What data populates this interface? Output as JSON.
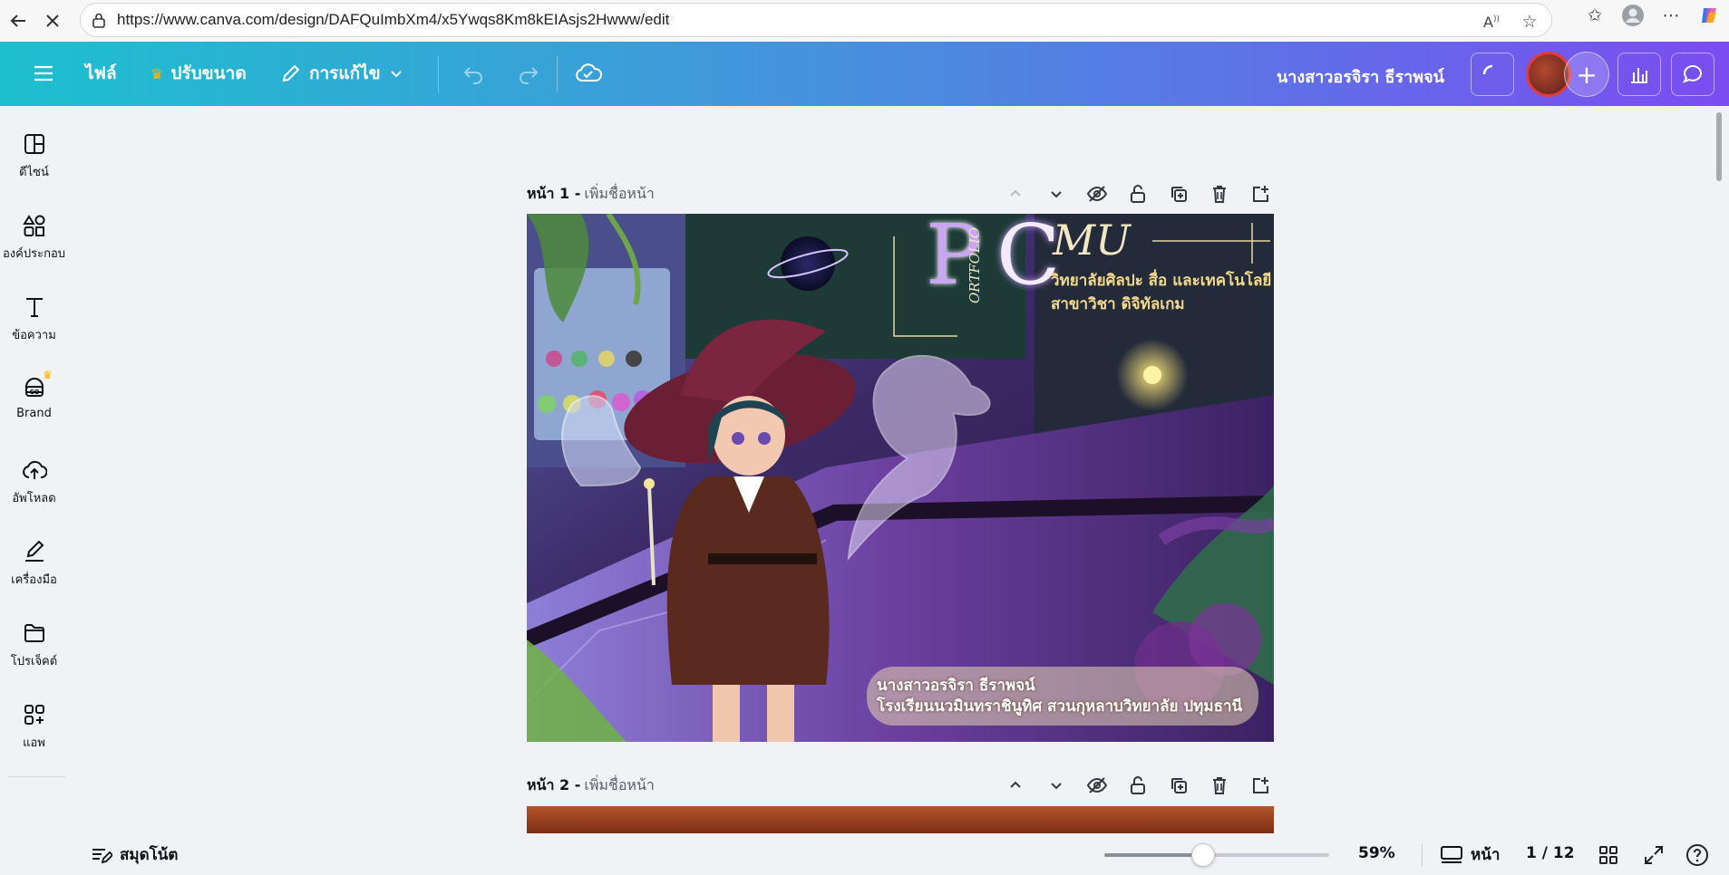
{
  "browser": {
    "url": "https://www.canva.com/design/DAFQuImbXm4/x5Ywqs8Km8kEIAsjs2Hwww/edit"
  },
  "header": {
    "file_label": "ไฟล์",
    "resize_label": "ปรับขนาด",
    "edit_label": "การแก้ไข",
    "design_title": "นางสาวอรจิรา ธีราพจน์"
  },
  "sidebar": {
    "items": [
      {
        "label": "ดีไซน์",
        "icon": "layout-icon"
      },
      {
        "label": "องค์ประกอบ",
        "icon": "shapes-icon"
      },
      {
        "label": "ข้อความ",
        "icon": "text-icon"
      },
      {
        "label": "Brand",
        "icon": "brand-icon"
      },
      {
        "label": "อัพโหลด",
        "icon": "cloud-upload-icon"
      },
      {
        "label": "เครื่องมือ",
        "icon": "draw-tool-icon"
      },
      {
        "label": "โปรเจ็คต์",
        "icon": "folder-icon"
      },
      {
        "label": "แอพ",
        "icon": "apps-icon"
      }
    ]
  },
  "pages": [
    {
      "label": "หน้า 1 -",
      "title_placeholder": "เพิ่มชื่อหน้า"
    },
    {
      "label": "หน้า 2 -",
      "title_placeholder": "เพิ่มชื่อหน้า"
    }
  ],
  "artwork": {
    "logo_p": "P",
    "logo_c": "C",
    "logo_mu": "MU",
    "portfolio": "ORTFOLIO",
    "faculty": "วิทยาลัยศิลปะ สื่อ และเทคโนโลยี",
    "major": "สาขาวิชา ดิจิทัลเกม",
    "student_name": "นางสาวอรจิรา ธีราพจน์",
    "school": "โรงเรียนนวมินทราชินูทิศ สวนกุหลาบวิทยาลัย ปทุมธานี"
  },
  "footer": {
    "notes_label": "สมุดโน้ต",
    "zoom_value": "59%",
    "zoom_fraction": 0.44,
    "pages_label": "หน้า",
    "page_count": "1 / 12"
  },
  "colors": {
    "header_start": "#1dbfcf",
    "header_end": "#7b4cf0",
    "canvas_bg": "#f1f2f6"
  }
}
